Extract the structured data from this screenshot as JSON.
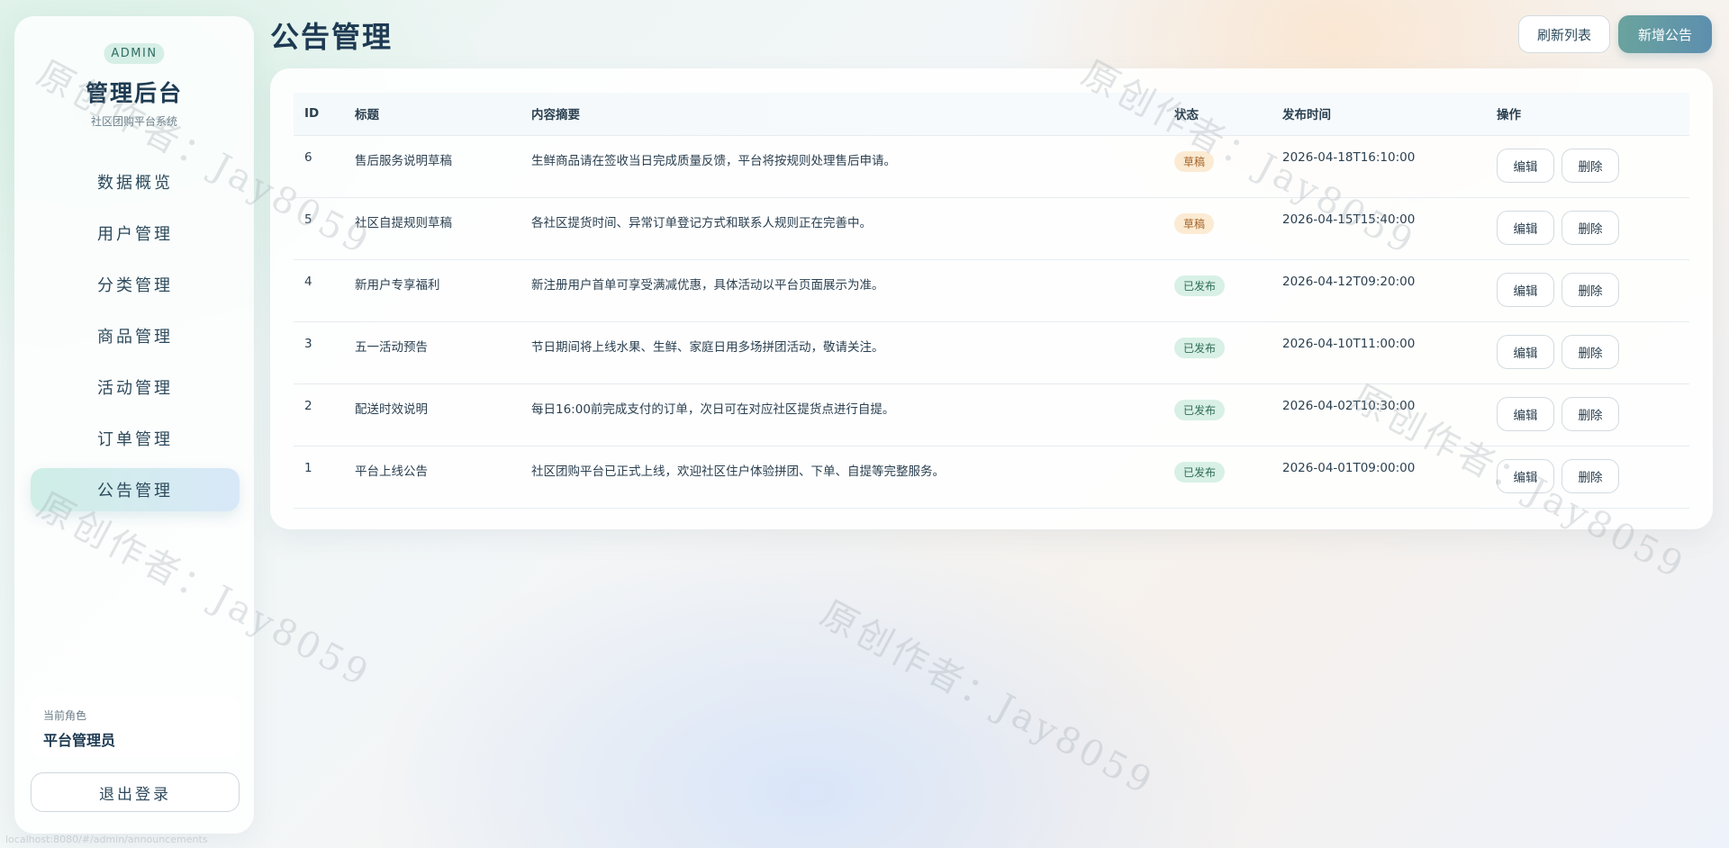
{
  "sidebar": {
    "badge": "ADMIN",
    "title": "管理后台",
    "subtitle": "社区团购平台系统",
    "items": [
      {
        "label": "数据概览"
      },
      {
        "label": "用户管理"
      },
      {
        "label": "分类管理"
      },
      {
        "label": "商品管理"
      },
      {
        "label": "活动管理"
      },
      {
        "label": "订单管理"
      },
      {
        "label": "公告管理",
        "active": true
      }
    ],
    "role_label": "当前角色",
    "role_value": "平台管理员",
    "logout_label": "退出登录"
  },
  "header": {
    "title": "公告管理",
    "refresh_label": "刷新列表",
    "add_label": "新增公告"
  },
  "table": {
    "columns": [
      "ID",
      "标题",
      "内容摘要",
      "状态",
      "发布时间",
      "操作"
    ],
    "edit_label": "编辑",
    "delete_label": "删除",
    "rows": [
      {
        "id": "6",
        "title": "售后服务说明草稿",
        "summary": "生鲜商品请在签收当日完成质量反馈，平台将按规则处理售后申请。",
        "status": "草稿",
        "status_type": "draft",
        "time": "2026-04-18T16:10:00"
      },
      {
        "id": "5",
        "title": "社区自提规则草稿",
        "summary": "各社区提货时间、异常订单登记方式和联系人规则正在完善中。",
        "status": "草稿",
        "status_type": "draft",
        "time": "2026-04-15T15:40:00"
      },
      {
        "id": "4",
        "title": "新用户专享福利",
        "summary": "新注册用户首单可享受满减优惠，具体活动以平台页面展示为准。",
        "status": "已发布",
        "status_type": "pub",
        "time": "2026-04-12T09:20:00"
      },
      {
        "id": "3",
        "title": "五一活动预告",
        "summary": "节日期间将上线水果、生鲜、家庭日用多场拼团活动，敬请关注。",
        "status": "已发布",
        "status_type": "pub",
        "time": "2026-04-10T11:00:00"
      },
      {
        "id": "2",
        "title": "配送时效说明",
        "summary": "每日16:00前完成支付的订单，次日可在对应社区提货点进行自提。",
        "status": "已发布",
        "status_type": "pub",
        "time": "2026-04-02T10:30:00"
      },
      {
        "id": "1",
        "title": "平台上线公告",
        "summary": "社区团购平台已正式上线，欢迎社区住户体验拼团、下单、自提等完整服务。",
        "status": "已发布",
        "status_type": "pub",
        "time": "2026-04-01T09:00:00"
      }
    ]
  },
  "watermark": "原创作者：Jay8059",
  "footer_url": "localhost:8080/#/admin/announcements",
  "colors": {
    "accent": "#6aa39e",
    "draft_bg": "#fcebd3",
    "published_bg": "#d8f0e6"
  }
}
